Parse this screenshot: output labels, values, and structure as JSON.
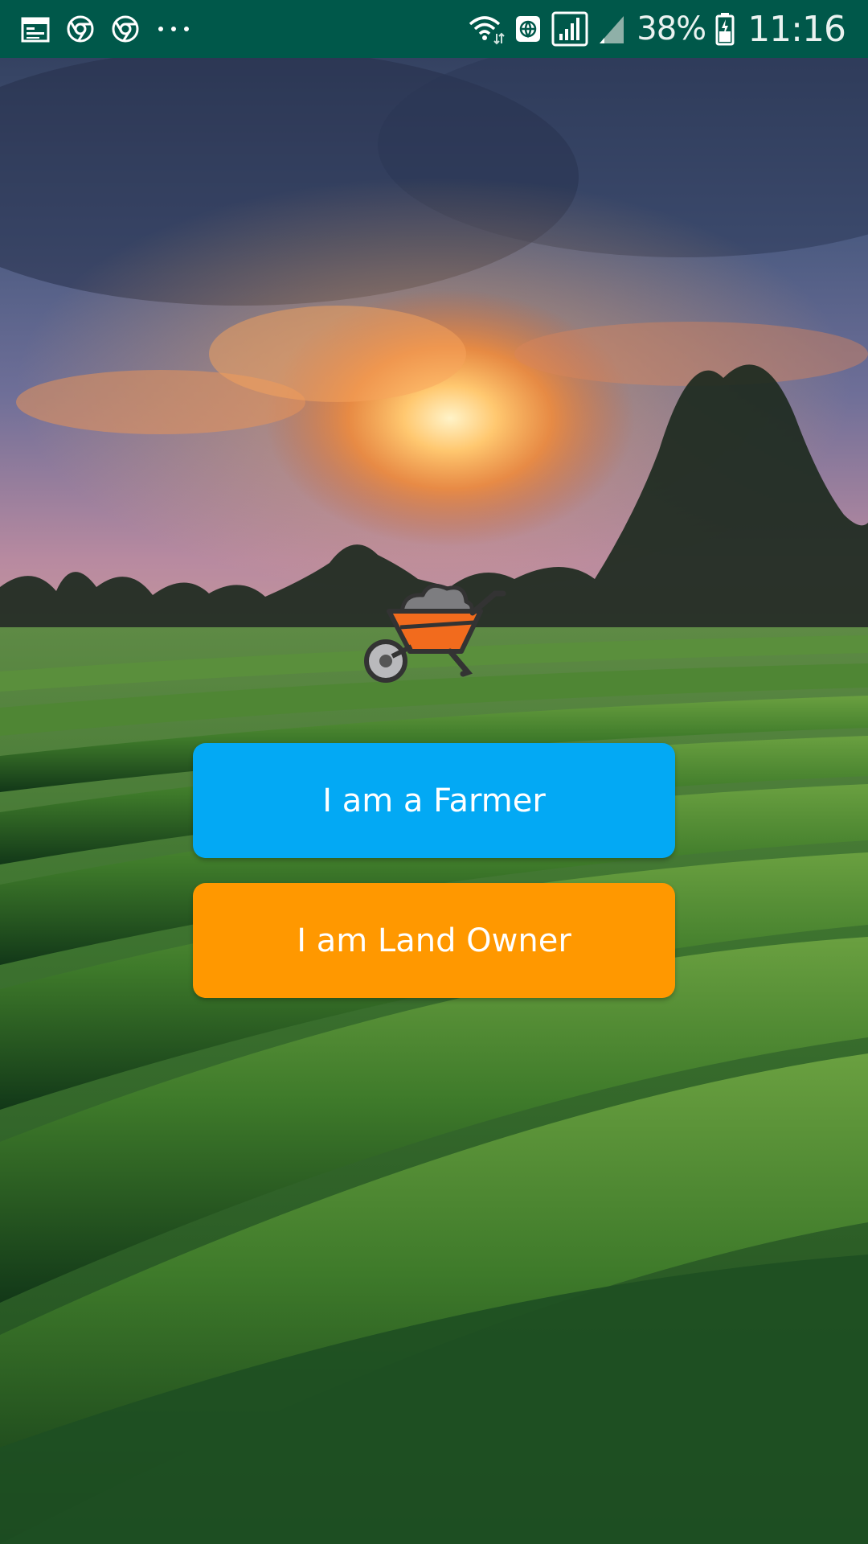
{
  "status_bar": {
    "battery_percent": "38%",
    "time": "11:16",
    "background": "#00584a",
    "left_icons": [
      "calendar-icon",
      "chrome-icon",
      "chrome-icon",
      "more-dots-icon"
    ],
    "right_icons": [
      "wifi-icon",
      "vpn-globe-icon",
      "signal-icon",
      "signal-icon",
      "battery-icon"
    ]
  },
  "main": {
    "logo_icon": "wheelbarrow-icon",
    "farmer_button": {
      "label": "I am a Farmer",
      "color": "#03a9f4"
    },
    "owner_button": {
      "label": "I am Land Owner",
      "color": "#ff9800"
    }
  }
}
